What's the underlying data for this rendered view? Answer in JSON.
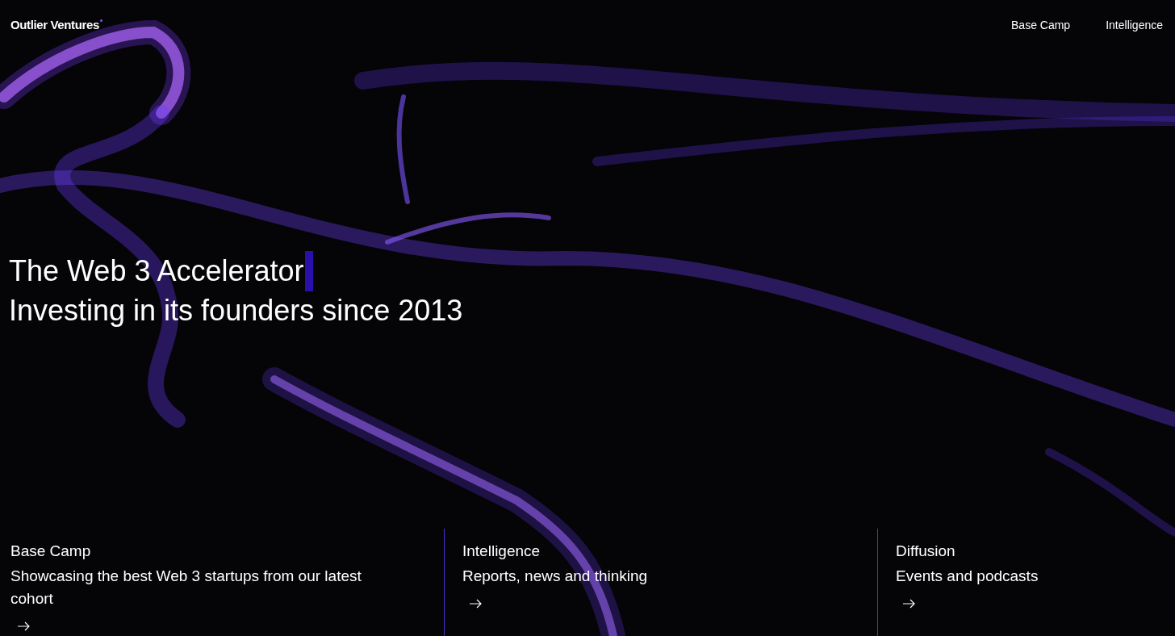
{
  "header": {
    "logo": "Outlier Ventures",
    "nav": [
      {
        "label": "Base Camp"
      },
      {
        "label": "Intelligence"
      }
    ]
  },
  "hero": {
    "lines": [
      "The Web 3 Accelerator",
      "Investing in its founders since 2013"
    ]
  },
  "sections": [
    {
      "title": "Base Camp",
      "description": "Showcasing the best Web 3 startups from our latest cohort"
    },
    {
      "title": "Intelligence",
      "description": "Reports, news and thinking"
    },
    {
      "title": "Diffusion",
      "description": "Events and podcasts"
    }
  ]
}
